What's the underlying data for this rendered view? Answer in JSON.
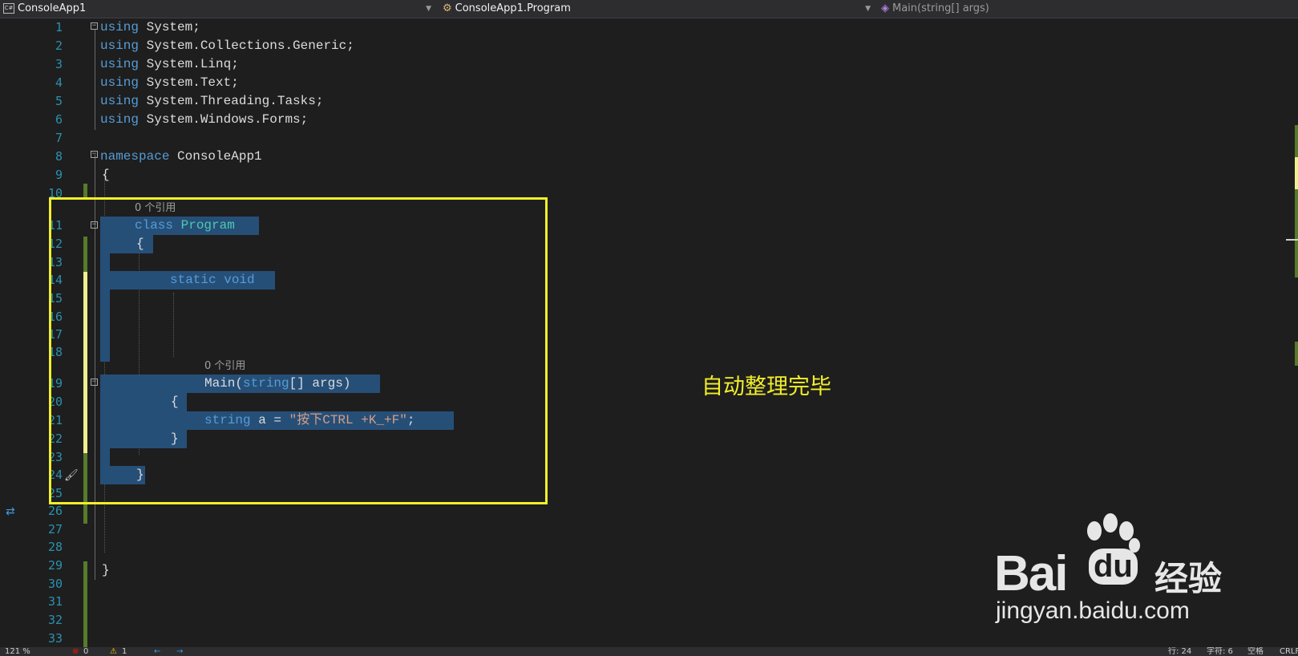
{
  "navbar": {
    "project": "ConsoleApp1",
    "class": "ConsoleApp1.Program",
    "member": "Main(string[] args)",
    "project_icon": "csharp-project-icon",
    "class_icon": "class-icon",
    "member_icon": "method-icon"
  },
  "editor": {
    "line_numbers": [
      "1",
      "2",
      "3",
      "4",
      "5",
      "6",
      "7",
      "8",
      "9",
      "10",
      "11",
      "12",
      "13",
      "14",
      "15",
      "16",
      "17",
      "18",
      "19",
      "20",
      "21",
      "22",
      "23",
      "24",
      "25",
      "26",
      "27",
      "28",
      "29",
      "30",
      "31",
      "32",
      "33"
    ],
    "codelens_class": "0 个引用",
    "codelens_main": "0 个引用",
    "code": {
      "l1_kw": "using",
      "l1_rest": " System;",
      "l2_kw": "using",
      "l2_rest": " System.Collections.Generic;",
      "l3_kw": "using",
      "l3_rest": " System.Linq;",
      "l4_kw": "using",
      "l4_rest": " System.Text;",
      "l5_kw": "using",
      "l5_rest": " System.Threading.Tasks;",
      "l6_kw": "using",
      "l6_rest": " System.Windows.Forms;",
      "l8_kw": "namespace",
      "l8_rest": " ConsoleApp1",
      "l9": "{",
      "l11_kw": "class",
      "l11_ty": "Program",
      "l12": "{",
      "l14": "static void",
      "l19_name": "Main(",
      "l19_kw": "string",
      "l19_rest": "[] args)",
      "l20": "{",
      "l21_kw": "string",
      "l21_var": " a = ",
      "l21_str": "\"按下CTRL +K_+F\"",
      "l21_end": ";",
      "l22": "}",
      "l24": "}",
      "l29": "}"
    }
  },
  "annotation": "自动整理完毕",
  "statusbar": {
    "zoom": "121 %",
    "errors": "0",
    "warnings": "1",
    "line": "行: 24",
    "char": "字符: 6",
    "space": "空格",
    "crlf": "CRLF"
  },
  "watermark": {
    "brand": "Bai",
    "brand_du": "du",
    "brand_cn": "经验",
    "url": "jingyan.baidu.com"
  },
  "colors": {
    "highlight": "#f2ef2a",
    "selection": "#264f78",
    "keyword": "#569cd6",
    "type": "#4ec9b0",
    "string": "#d69d85"
  }
}
